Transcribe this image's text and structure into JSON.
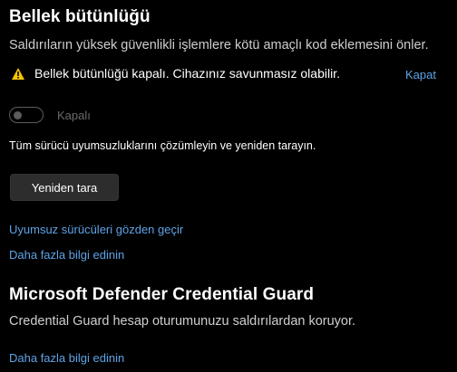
{
  "memory_integrity": {
    "title": "Bellek bütünlüğü",
    "description": "Saldırıların yüksek güvenlikli işlemlere kötü amaçlı kod eklemesini önler.",
    "warning_text": "Bellek bütünlüğü kapalı. Cihazınız savunmasız olabilir.",
    "dismiss_label": "Kapat",
    "toggle_state_label": "Kapalı",
    "toggle_on": false,
    "rescan_hint": "Tüm sürücü uyumsuzluklarını çözümleyin ve yeniden tarayın.",
    "rescan_button": "Yeniden tara",
    "review_drivers_link": "Uyumsuz sürücüleri gözden geçir",
    "learn_more_link": "Daha fazla bilgi edinin"
  },
  "credential_guard": {
    "title": "Microsoft Defender Credential Guard",
    "description": "Credential Guard hesap oturumunuzu saldırılardan koruyor.",
    "learn_more_link": "Daha fazla bilgi edinin"
  },
  "colors": {
    "background": "#000000",
    "link": "#5ea3e6",
    "warning": "#f5c400"
  },
  "icons": {
    "warning": "warning-triangle-icon"
  }
}
